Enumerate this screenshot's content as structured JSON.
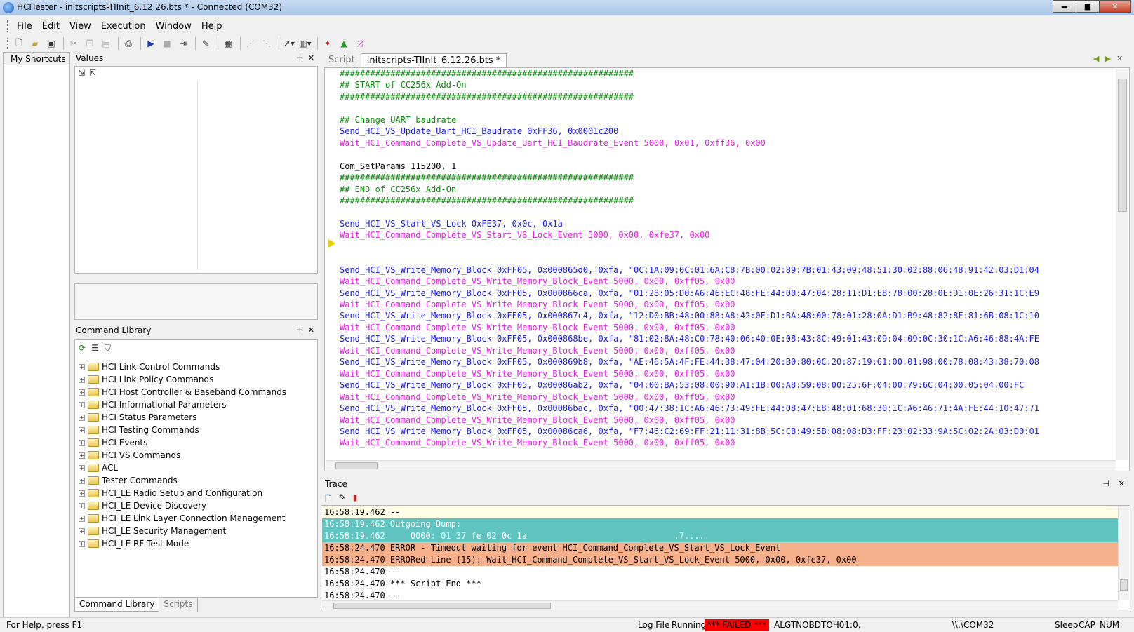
{
  "window": {
    "title": "HCITester - initscripts-TIInit_6.12.26.bts * - Connected (COM32)",
    "minimize": "▬",
    "maximize": "■",
    "close": "✕"
  },
  "menu": [
    "File",
    "Edit",
    "View",
    "Execution",
    "Window",
    "Help"
  ],
  "toolbar_icons": [
    "new-file-icon",
    "open-folder-icon",
    "save-icon",
    "cut-icon",
    "copy-icon",
    "paste-icon",
    "print-icon",
    "run-icon",
    "stop-icon",
    "step-icon",
    "clear-icon",
    "properties-icon",
    "trace-icon",
    "trace-off-icon",
    "cursor-icon",
    "options-icon",
    "connect-icon",
    "chart-icon",
    "shuffle-icon"
  ],
  "shortcuts": {
    "header": "My Shortcuts"
  },
  "values": {
    "header": "Values"
  },
  "command_library": {
    "header": "Command Library",
    "items": [
      "HCI Link Control Commands",
      "HCI Link Policy Commands",
      "HCI Host Controller & Baseband Commands",
      "HCI Informational Parameters",
      "HCI Status Parameters",
      "HCI Testing Commands",
      "HCI Events",
      "HCI VS Commands",
      "ACL",
      "Tester Commands",
      "HCI_LE Radio Setup and Configuration",
      "HCI_LE Device Discovery",
      "HCI_LE Link Layer Connection Management",
      "HCI_LE Security Management",
      "HCI_LE RF Test Mode"
    ],
    "bottom_tabs": [
      "Command Library",
      "Scripts"
    ]
  },
  "script": {
    "tabs": [
      "Script",
      "initscripts-TIInit_6.12.26.bts *"
    ],
    "lines": [
      {
        "t": "##########################################################",
        "c": "green"
      },
      {
        "t": "## START of CC256x Add-On",
        "c": "green"
      },
      {
        "t": "##########################################################",
        "c": "green"
      },
      {
        "t": "",
        "c": "black"
      },
      {
        "t": "## Change UART baudrate",
        "c": "green"
      },
      {
        "t": "Send_HCI_VS_Update_Uart_HCI_Baudrate 0xFF36, 0x0001c200",
        "c": "blue"
      },
      {
        "t": "Wait_HCI_Command_Complete_VS_Update_Uart_HCI_Baudrate_Event 5000, 0x01, 0xff36, 0x00",
        "c": "magenta"
      },
      {
        "t": "",
        "c": "black"
      },
      {
        "t": "Com_SetParams 115200, 1",
        "c": "black"
      },
      {
        "t": "##########################################################",
        "c": "green"
      },
      {
        "t": "## END of CC256x Add-On",
        "c": "green"
      },
      {
        "t": "##########################################################",
        "c": "green"
      },
      {
        "t": "",
        "c": "black"
      },
      {
        "t": "Send_HCI_VS_Start_VS_Lock 0xFE37, 0x0c, 0x1a",
        "c": "blue"
      },
      {
        "t": "Wait_HCI_Command_Complete_VS_Start_VS_Lock_Event 5000, 0x00, 0xfe37, 0x00",
        "c": "magenta"
      },
      {
        "t": "",
        "c": "black"
      },
      {
        "t": "",
        "c": "black"
      },
      {
        "t": "Send_HCI_VS_Write_Memory_Block 0xFF05, 0x000865d0, 0xfa, \"0C:1A:09:0C:01:6A:C8:7B:00:02:89:7B:01:43:09:48:51:30:02:88:06:48:91:42:03:D1:04",
        "c": "blue"
      },
      {
        "t": "Wait_HCI_Command_Complete_VS_Write_Memory_Block_Event 5000, 0x00, 0xff05, 0x00",
        "c": "magenta"
      },
      {
        "t": "Send_HCI_VS_Write_Memory_Block 0xFF05, 0x000866ca, 0xfa, \"01:28:05:D0:A6:46:EC:48:FE:44:00:47:04:28:11:D1:E8:78:00:28:0E:D1:0E:26:31:1C:E9",
        "c": "blue"
      },
      {
        "t": "Wait_HCI_Command_Complete_VS_Write_Memory_Block_Event 5000, 0x00, 0xff05, 0x00",
        "c": "magenta"
      },
      {
        "t": "Send_HCI_VS_Write_Memory_Block 0xFF05, 0x000867c4, 0xfa, \"12:D0:BB:48:00:88:A8:42:0E:D1:BA:48:00:78:01:28:0A:D1:B9:48:82:8F:81:6B:08:1C:10",
        "c": "blue"
      },
      {
        "t": "Wait_HCI_Command_Complete_VS_Write_Memory_Block_Event 5000, 0x00, 0xff05, 0x00",
        "c": "magenta"
      },
      {
        "t": "Send_HCI_VS_Write_Memory_Block 0xFF05, 0x000868be, 0xfa, \"81:02:8A:48:C0:78:40:06:40:0E:08:43:8C:49:01:43:09:04:09:0C:30:1C:A6:46:88:4A:FE",
        "c": "blue"
      },
      {
        "t": "Wait_HCI_Command_Complete_VS_Write_Memory_Block_Event 5000, 0x00, 0xff05, 0x00",
        "c": "magenta"
      },
      {
        "t": "Send_HCI_VS_Write_Memory_Block 0xFF05, 0x000869b8, 0xfa, \"AE:46:5A:4F:FE:44:38:47:04:20:B0:80:0C:20:87:19:61:00:01:98:00:78:08:43:38:70:08",
        "c": "blue"
      },
      {
        "t": "Wait_HCI_Command_Complete_VS_Write_Memory_Block_Event 5000, 0x00, 0xff05, 0x00",
        "c": "magenta"
      },
      {
        "t": "Send_HCI_VS_Write_Memory_Block 0xFF05, 0x00086ab2, 0xfa, \"04:00:BA:53:08:00:90:A1:1B:00:A8:59:08:00:25:6F:04:00:79:6C:04:00:05:04:00:FC",
        "c": "blue"
      },
      {
        "t": "Wait_HCI_Command_Complete_VS_Write_Memory_Block_Event 5000, 0x00, 0xff05, 0x00",
        "c": "magenta"
      },
      {
        "t": "Send_HCI_VS_Write_Memory_Block 0xFF05, 0x00086bac, 0xfa, \"00:47:38:1C:A6:46:73:49:FE:44:08:47:E8:48:01:68:30:1C:A6:46:71:4A:FE:44:10:47:71",
        "c": "blue"
      },
      {
        "t": "Wait_HCI_Command_Complete_VS_Write_Memory_Block_Event 5000, 0x00, 0xff05, 0x00",
        "c": "magenta"
      },
      {
        "t": "Send_HCI_VS_Write_Memory_Block 0xFF05, 0x00086ca6, 0xfa, \"F7:46:C2:69:FF:21:11:31:8B:5C:CB:49:5B:08:08:D3:FF:23:02:33:9A:5C:02:2A:03:D0:01",
        "c": "blue"
      },
      {
        "t": "Wait_HCI_Command_Complete_VS_Write_Memory_Block_Event 5000, 0x00, 0xff05, 0x00",
        "c": "magenta"
      }
    ]
  },
  "trace": {
    "header": "Trace",
    "lines": [
      {
        "t": "16:58:19.462 --",
        "bg": "#fffde8"
      },
      {
        "t": "16:58:19.462 Outgoing Dump:",
        "bg": "#5fc3c0",
        "fg": "#ffffff"
      },
      {
        "t": "16:58:19.462     0000: 01 37 fe 02 0c 1a                             .7....",
        "bg": "#5fc3c0",
        "fg": "#ffffff"
      },
      {
        "t": "16:58:24.470 ERROR - Timeout waiting for event HCI_Command_Complete_VS_Start_VS_Lock_Event",
        "bg": "#f7b08c",
        "fg": "#000000"
      },
      {
        "t": "16:58:24.470 ERRORed Line (15): Wait_HCI_Command_Complete_VS_Start_VS_Lock_Event 5000, 0x00, 0xfe37, 0x00",
        "bg": "#f7b08c",
        "fg": "#000000"
      },
      {
        "t": "16:58:24.470 --",
        "bg": "#ffffff"
      },
      {
        "t": "16:58:24.470 *** Script End ***",
        "bg": "#ffffff"
      },
      {
        "t": "16:58:24.470 --",
        "bg": "#ffffff"
      }
    ]
  },
  "statusbar": {
    "help": "For Help, press F1",
    "log_file": "Log File",
    "running": "Running",
    "failed": "*** FAILED ***",
    "device": "ALGTNOBDTOH01:0,",
    "port": "\\\\.\\COM32",
    "sleep": "Sleep",
    "cap": "CAP",
    "num": "NUM"
  }
}
